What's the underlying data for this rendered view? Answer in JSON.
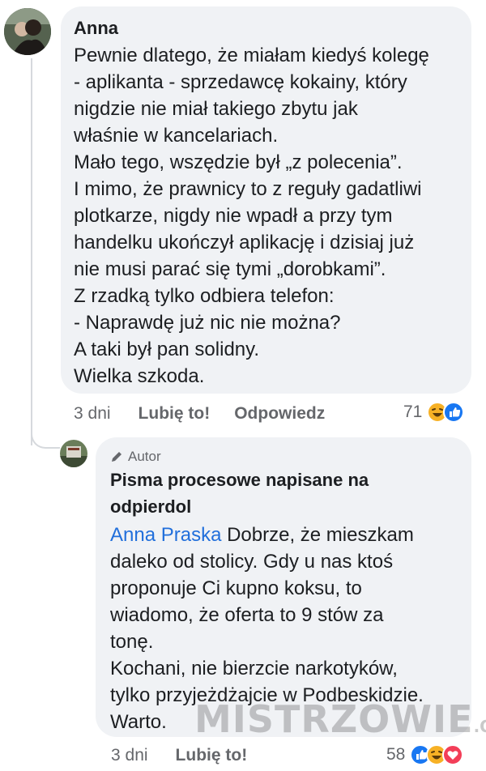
{
  "comment1": {
    "author": "Anna",
    "text": "Pewnie dlatego, że miałam kiedyś kolegę\n- aplikanta - sprzedawcę kokainy, który\nnigdzie nie miał takiego zbytu jak\nwłaśnie w kancelariach.\nMało tego, wszędzie był „z polecenia”.\nI mimo, że prawnicy to z reguły gadatliwi\nplotkarze, nigdy nie wpadł a przy tym\nhandelku ukończył aplikację i dzisiaj już\nnie musi parać się tymi „dorobkami”.\nZ rzadką tylko odbiera telefon:\n- Naprawdę już nic nie można?\nA taki był pan solidny.\nWielka szkoda.",
    "time": "3 dni",
    "like_label": "Lubię to!",
    "reply_label": "Odpowiedz",
    "reaction_count": "71"
  },
  "comment2": {
    "badge": "Autor",
    "author": "Pisma procesowe napisane na\nodpierdol",
    "mention": "Anna Praska",
    "text": " Dobrze, że mieszkam\ndaleko od stolicy. Gdy u nas ktoś\nproponuje Ci kupno koksu, to\nwiadomo, że oferta to 9 stów za\ntonę.\nKochani, nie bierzcie narkotyków,\ntylko przyjeżdżajcie w Podbeskidzie.\nWarto.",
    "time": "3 dni",
    "like_label": "Lubię to!",
    "reaction_count": "58"
  },
  "watermark": {
    "text": "MISTRZOWIE",
    "suffix": ".ORG"
  },
  "colors": {
    "bubble": "#f0f2f5",
    "mention": "#216fdb",
    "meta": "#65676b",
    "like": "#1877f2",
    "haha": "#f7b125",
    "love": "#f33e58"
  }
}
